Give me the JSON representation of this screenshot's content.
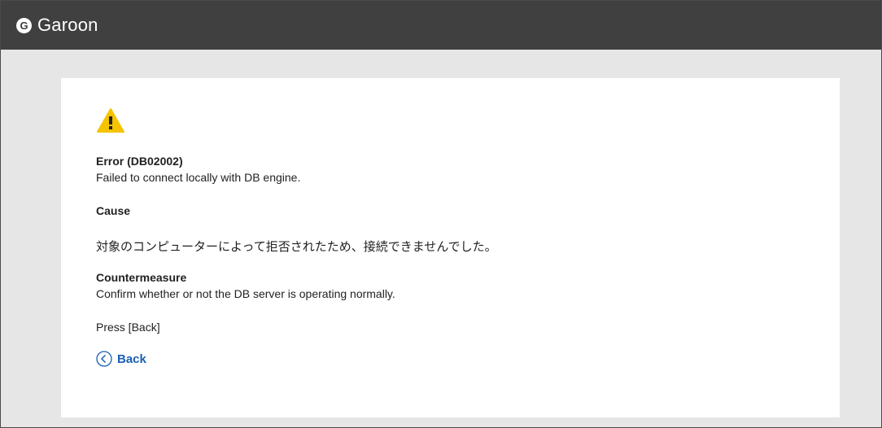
{
  "header": {
    "logo_letter": "G",
    "app_name": "Garoon",
    "background_color": "#404040"
  },
  "error": {
    "icon": "warning-icon",
    "title": "Error (DB02002)",
    "message": "Failed to connect locally with DB engine.",
    "cause_heading": "Cause",
    "cause_text": "対象のコンピューターによって拒否されたため、接続できませんでした。",
    "countermeasure_heading": "Countermeasure",
    "countermeasure_text": "Confirm whether or not the DB server is operating normally.",
    "instruction": "Press [Back]"
  },
  "actions": {
    "back_label": "Back",
    "back_icon": "chevron-left-circle-icon",
    "link_color": "#1a5fb4"
  },
  "colors": {
    "warning_fill": "#f5c400",
    "page_background": "#e6e6e6",
    "card_background": "#ffffff"
  }
}
